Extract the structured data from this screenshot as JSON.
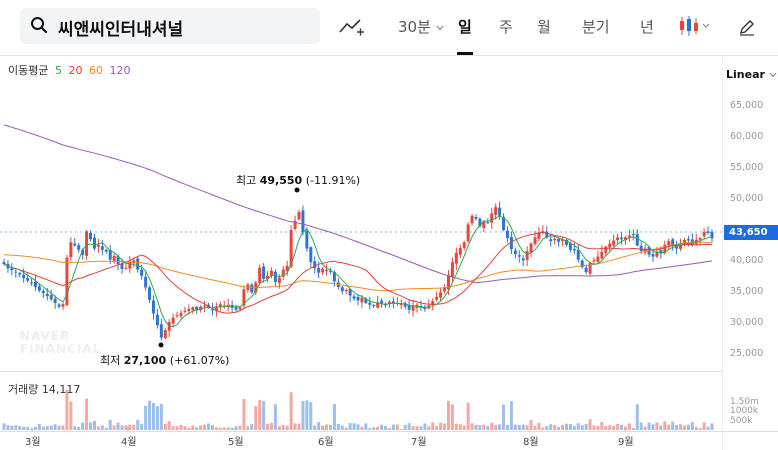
{
  "search": {
    "query": "씨앤씨인터내셔널"
  },
  "toolbar": {
    "chart_type_icon": "line-chart-add-icon",
    "interval": "30분",
    "tabs": [
      "일",
      "주",
      "월",
      "분기",
      "년"
    ],
    "active_tab": "일",
    "candle_icon": "candlestick-icon",
    "draw_icon": "pencil-icon"
  },
  "legend": {
    "label": "이동평균",
    "periods": [
      "5",
      "20",
      "60",
      "120"
    ]
  },
  "colors": {
    "ma5": "#2fa84f",
    "ma20": "#e0403a",
    "ma60": "#f08a24",
    "ma120": "#9b59b6",
    "up": "#e8453c",
    "down": "#2f74d0",
    "accent": "#1e6ae0"
  },
  "scale_mode": "Linear",
  "current_price": "43,650",
  "annotations": {
    "high": {
      "label": "최고",
      "value": "49,550",
      "pct": "(-11.91%)"
    },
    "low": {
      "label": "최저",
      "value": "27,100",
      "pct": "(+61.07%)"
    }
  },
  "volume": {
    "label": "거래량",
    "value": "14,117",
    "ticks": [
      "1.50m",
      "1000k",
      "500k"
    ]
  },
  "watermark": [
    "NAVER",
    "FINANCIAL"
  ],
  "chart_data": {
    "type": "candlestick",
    "yticks": [
      "65,000",
      "60,000",
      "55,000",
      "50,000",
      "45,000",
      "40,000",
      "35,000",
      "30,000",
      "25,000"
    ],
    "ylim": [
      23000,
      67000
    ],
    "xticks": [
      "3월",
      "4월",
      "5월",
      "6월",
      "7월",
      "8월",
      "9월"
    ],
    "closes": [
      39500,
      38800,
      38500,
      38200,
      37800,
      37200,
      36800,
      36400,
      35800,
      35200,
      34800,
      34300,
      33800,
      33200,
      32600,
      33000,
      40500,
      43000,
      42500,
      41800,
      41000,
      44800,
      43500,
      42000,
      42600,
      41800,
      41500,
      40200,
      40800,
      39500,
      38700,
      38900,
      39800,
      40100,
      38600,
      37600,
      35700,
      33700,
      31500,
      29600,
      27600,
      28800,
      30100,
      30800,
      31200,
      31600,
      31900,
      32200,
      32500,
      32100,
      32600,
      32800,
      32400,
      32100,
      32600,
      33000,
      32800,
      32900,
      32400,
      32100,
      32500,
      35400,
      36200,
      34900,
      36500,
      38900,
      37100,
      37600,
      38400,
      36600,
      37300,
      38600,
      39200,
      45000,
      46500,
      47900,
      44600,
      42000,
      39800,
      38800,
      38100,
      38700,
      38500,
      38300,
      36700,
      35800,
      35100,
      35300,
      34400,
      33900,
      33600,
      34000,
      33200,
      32900,
      32700,
      33300,
      33100,
      32800,
      33400,
      33100,
      33200,
      33000,
      32600,
      32100,
      32700,
      32900,
      32400,
      32200,
      32800,
      33500,
      34200,
      34900,
      35600,
      37700,
      39800,
      41300,
      42100,
      43000,
      45900,
      47300,
      46800,
      45600,
      46400,
      46200,
      47700,
      48700,
      47300,
      45000,
      43700,
      41900,
      41100,
      40700,
      40100,
      41600,
      42800,
      43800,
      44600,
      44800,
      43800,
      43200,
      43600,
      43100,
      43500,
      42600,
      41800,
      41700,
      40200,
      39000,
      38200,
      39700,
      40100,
      40700,
      41500,
      42300,
      42800,
      43300,
      43800,
      43500,
      43800,
      44100,
      44300,
      42500,
      41600,
      42000,
      41000,
      40700,
      41500,
      41200,
      42600,
      43200,
      42500,
      42000,
      42900,
      43400,
      43300,
      42500,
      43400,
      43700,
      44700,
      44500,
      43650
    ],
    "volume_scale_max": 1500000
  }
}
